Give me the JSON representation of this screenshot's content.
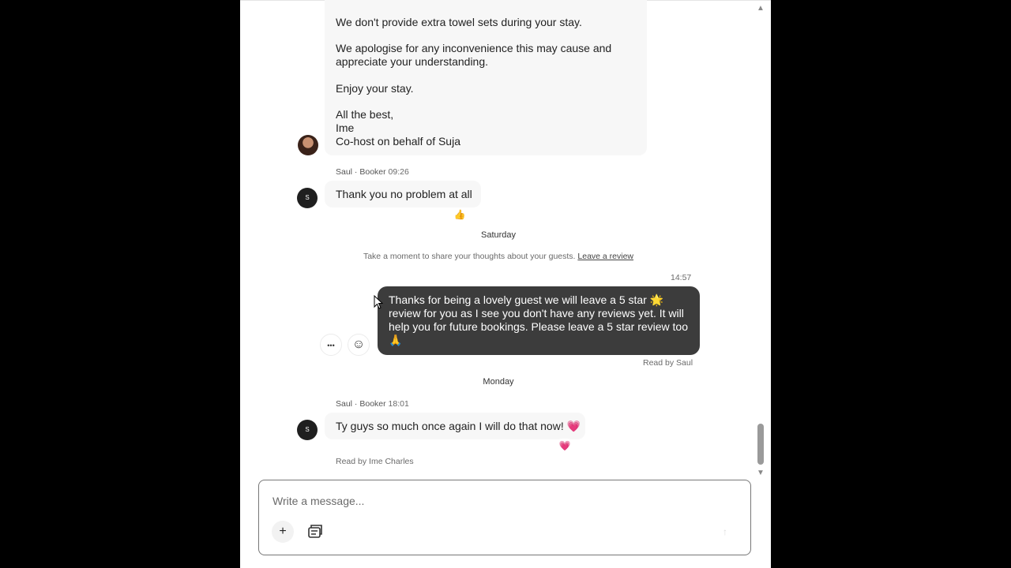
{
  "thread": {
    "host_message": {
      "paragraphs": [
        "We don't provide extra towel sets during your stay.",
        "We apologise for any inconvenience this may cause and\nappreciate your understanding.",
        "Enjoy your stay.",
        "All the best,\nIme\nCo-host on behalf of Suja"
      ]
    },
    "guest_message_1": {
      "sender": "Saul · Booker",
      "time": "09:26",
      "avatar_initial": "S",
      "text": "Thank you no problem at all",
      "reaction": "👍"
    },
    "day_saturday": "Saturday",
    "review_prompt": {
      "text": "Take a moment to share your thoughts about your guests.",
      "link": "Leave a review"
    },
    "host_reply": {
      "time": "14:57",
      "text": "Thanks for being a lovely guest we will leave a 5 star 🌟\nreview for you as I see you don't have any reviews yet. It will\nhelp you for future bookings. Please leave a 5 star review too\n🙏",
      "read_receipt": "Read by Saul"
    },
    "day_monday": "Monday",
    "guest_message_2": {
      "sender": "Saul · Booker",
      "time": "18:01",
      "avatar_initial": "S",
      "text": "Ty guys so much once again I will do that now! 💗",
      "reaction": "💗",
      "read_receipt": "Read by Ime Charles"
    }
  },
  "actions": {
    "more_icon": "•••",
    "emoji_icon": "☺"
  },
  "composer": {
    "placeholder": "Write a message...",
    "plus_icon": "+",
    "send_icon": "↑"
  },
  "colors": {
    "outgoing_bubble": "#3c3c3c",
    "incoming_bubble": "#f7f7f7"
  }
}
